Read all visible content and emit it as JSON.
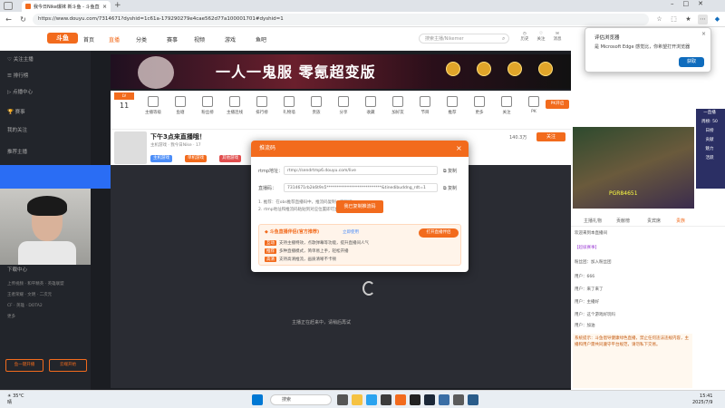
{
  "browser": {
    "tab_title": "我今日Nike爆袜 新斗鱼 - 斗鱼直播",
    "url": "https://www.douyu.com/7314671?dyshid=1c61a-179290279e4cae562d77a100001701#dyshid=1"
  },
  "notification": {
    "title": "评估浏览器",
    "desc": "是 Microsoft Edge 感觉比，你希望打开浏览器",
    "button": "获取"
  },
  "site": {
    "logo": "斗鱼",
    "nav": [
      "首页",
      "直播",
      "分类",
      "赛事",
      "视频",
      "游戏",
      "鱼吧"
    ],
    "search_placeholder": "搜索主播/Nikemer",
    "header_icons": [
      "历史",
      "关注",
      "消息",
      "头像",
      "下载",
      "开播"
    ]
  },
  "sidebar": {
    "items": [
      "关注主播",
      "排行榜",
      "点播中心",
      "赛事",
      "我的关注",
      "推荐主播",
      "直播间",
      "浏览记录"
    ],
    "bottom": [
      "下载中心",
      "上传视频",
      "和平精英",
      "英雄联盟",
      "王者荣耀",
      "英雄联盟",
      "文明",
      "二次元",
      "CF",
      "英雄",
      "DOTA2",
      "更多"
    ],
    "buttons": [
      "鱼一键开播",
      "云端开始"
    ]
  },
  "banner": {
    "title": "一人一鬼服 零氪超变版"
  },
  "room_tools": [
    "主播任务",
    "主播等级",
    "鱼塘",
    "粉丝榜",
    "主播连线",
    "排行榜",
    "礼物墙",
    "贵族",
    "分享",
    "收藏",
    "加好友",
    "节目",
    "推荐",
    "更多",
    "关注",
    "PK",
    "抽奖",
    "更多"
  ],
  "streamer": {
    "title": "下午3点来直播哦！",
    "category": "主机游戏",
    "name": "我今日Nike",
    "level_count": "17",
    "tags": [
      "主机游戏",
      "单机游戏",
      "其他游戏"
    ],
    "follow_count": "140.3万",
    "follow_label": "关注"
  },
  "video": {
    "tip": "主播正在赶来中，请稍后再试"
  },
  "popup": {
    "title": "推流码",
    "rtmp_label": "rtmp地址：",
    "rtmp_value": "rtmp://sendrtmp6.douyu.com/live",
    "rtmp_copy": "复制",
    "key_label": "直播码：",
    "key_value": "7314671rb2k6t9n5***************************&tinedibuddng_rdt=1",
    "key_copy": "复制",
    "note1": "1. 推荐：在obs推荐直播码中，推流码复制一下就行",
    "note2": "2. rtmp地址和推流码粘贴到对应位置即可直播开始",
    "confirm": "我已复制推流码",
    "promo_title": "斗鱼直播伴侣(官方推荐)",
    "promo_link": "立即使用",
    "promo_button": "打开直播伴侣",
    "promo_lines": [
      {
        "badge": "互动",
        "text": "支持主播特效，点歌弹幕等功能，提升直播间人气"
      },
      {
        "badge": "推荐",
        "text": "多种直播模式，简单易上手，轻松开播"
      },
      {
        "badge": "高清",
        "text": "支持高清推流，画质清晰不卡顿"
      }
    ]
  },
  "rightcol": {
    "pk_label": "PK开启",
    "rank": [
      "一直播",
      "周榜: 50",
      "日榜",
      "贡献",
      "魅力",
      "活跃"
    ],
    "game_caption": "PGR84651",
    "tabs": [
      "主播礼物",
      "贡献榜",
      "贵宾席",
      "贵族"
    ],
    "chat": [
      "欢迎来到本直播间",
      "【超级赛事】",
      "粉丝团：加入粉丝团",
      "用户：666",
      "用户：来了来了",
      "用户：主播好",
      "用户：这个游戏好玩吗",
      "用户：加油"
    ],
    "chat_notice": "系统提示：斗鱼倡导健康绿色直播，禁止任何违法违规内容，主播和用户需共同遵守平台规范，请勿私下交易。"
  },
  "taskbar": {
    "weather_temp": "35°C",
    "weather_desc": "晴",
    "search": "搜索",
    "time": "15:41",
    "date": "2025/7/9"
  }
}
